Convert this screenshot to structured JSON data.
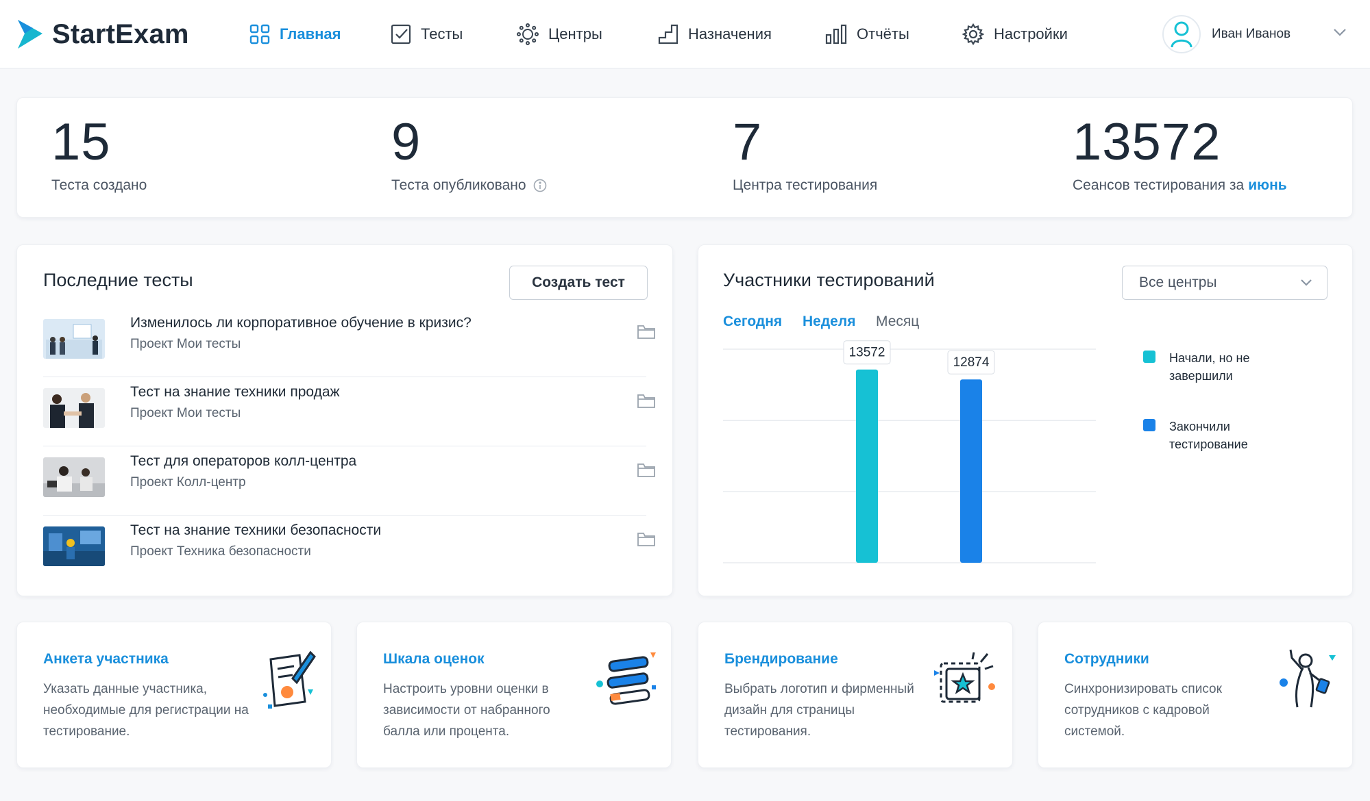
{
  "app": {
    "name": "StartExam"
  },
  "nav": {
    "items": [
      {
        "label": "Главная",
        "icon": "grid-icon",
        "active": true
      },
      {
        "label": "Тесты",
        "icon": "checkbox-icon"
      },
      {
        "label": "Центры",
        "icon": "sun-icon"
      },
      {
        "label": "Назначения",
        "icon": "steps-icon"
      },
      {
        "label": "Отчёты",
        "icon": "bar-chart-icon"
      },
      {
        "label": "Настройки",
        "icon": "gear-icon"
      }
    ],
    "user": "Иван Иванов"
  },
  "stats": [
    {
      "value": "15",
      "label": "Теста создано"
    },
    {
      "value": "9",
      "label": "Теста опубликовано"
    },
    {
      "value": "7",
      "label": "Центра тестирования"
    },
    {
      "value": "13572",
      "label": "Сеансов тестирования за",
      "accent": "июнь"
    }
  ],
  "recent": {
    "title": "Последние тесты",
    "create_label": "Создать тест",
    "items": [
      {
        "title": "Изменилось ли корпоративное обучение в кризис?",
        "project": "Проект Мои тесты"
      },
      {
        "title": "Тест на знание техники продаж",
        "project": "Проект Мои тесты"
      },
      {
        "title": "Тест для операторов колл-центра",
        "project": "Проект Колл-центр"
      },
      {
        "title": "Тест на знание техники безопасности",
        "project": "Проект Техника безопасности"
      }
    ]
  },
  "participants": {
    "title": "Участники тестирований",
    "select_value": "Все центры",
    "periods": [
      "Сегодня",
      "Неделя",
      "Месяц"
    ],
    "colors": {
      "started": "#16c1d4",
      "finished": "#1a82e8"
    }
  },
  "chart_data": {
    "type": "bar",
    "categories": [
      "Начали, но не завершили",
      "Закончили тестирование"
    ],
    "values": [
      13572,
      12874
    ],
    "series": [
      {
        "name": "Начали, но не завершили",
        "values": [
          13572
        ]
      },
      {
        "name": "Закончили тестирование",
        "values": [
          12874
        ]
      }
    ],
    "ylim": [
      0,
      15000
    ],
    "grid": true,
    "legend": "right"
  },
  "features": [
    {
      "title": "Анкета участника",
      "desc": "Указать данные участника, необходимые для регистрации на тестирование."
    },
    {
      "title": "Шкала оценок",
      "desc": "Настроить уровни оценки в зависимости от набранного балла или процента."
    },
    {
      "title": "Брендирование",
      "desc": "Выбрать логотип и фирменный дизайн для страницы тестирования."
    },
    {
      "title": "Сотрудники",
      "desc": "Синхронизировать список сотрудников с кадровой системой."
    }
  ]
}
